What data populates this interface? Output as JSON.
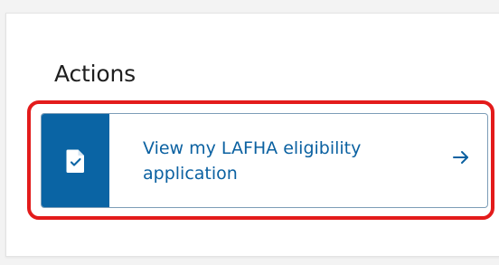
{
  "actions": {
    "title": "Actions",
    "item": {
      "label": "View my LAFHA eligibility application",
      "icon": "document-check-icon",
      "arrow_icon": "arrow-right-icon"
    }
  },
  "colors": {
    "accent": "#0a64a4",
    "link_text": "#0b61a1",
    "highlight": "#e31b1b",
    "card_border": "#7d9db7"
  }
}
